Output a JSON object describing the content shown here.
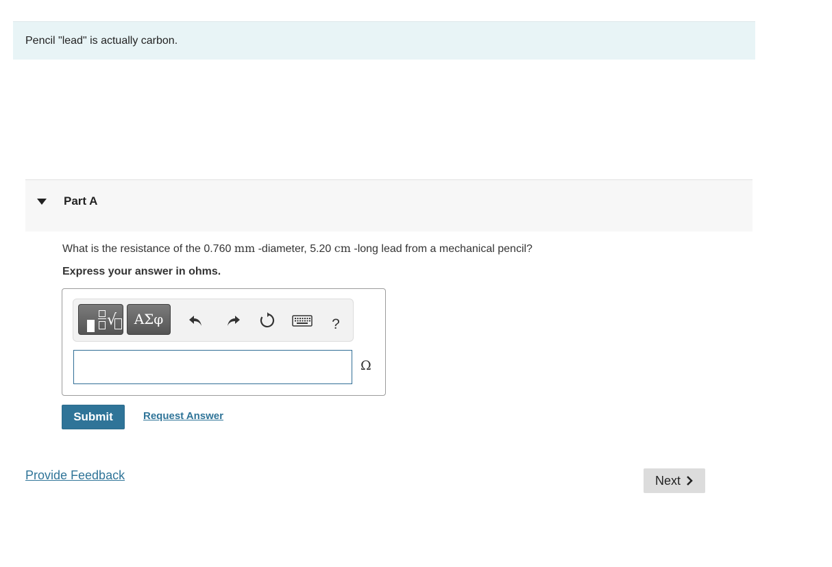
{
  "intro": {
    "text": "Pencil \"lead\" is actually carbon."
  },
  "part": {
    "title": "Part A"
  },
  "question": {
    "text_before": "What is the resistance of the 0.760 ",
    "unit_mm": "mm",
    "text_middle": " -diameter, 5.20 ",
    "unit_cm": "cm",
    "text_after": " -long lead from a mechanical pencil?",
    "instruction": "Express your answer in ohms."
  },
  "toolbar": {
    "greek_label": "ΑΣφ",
    "help_label": "?",
    "icons": [
      "templates-icon",
      "greek-symbols-icon",
      "undo-icon",
      "redo-icon",
      "reset-icon",
      "keyboard-icon",
      "help-icon"
    ]
  },
  "answer": {
    "value": "",
    "unit": "Ω"
  },
  "actions": {
    "submit_label": "Submit",
    "request_label": "Request Answer",
    "feedback_label": "Provide Feedback",
    "next_label": "Next"
  },
  "colors": {
    "intro_bg": "#e8f4f6",
    "accent": "#2f7498",
    "part_bg": "#f7f7f7",
    "next_bg": "#dcdcdc"
  }
}
